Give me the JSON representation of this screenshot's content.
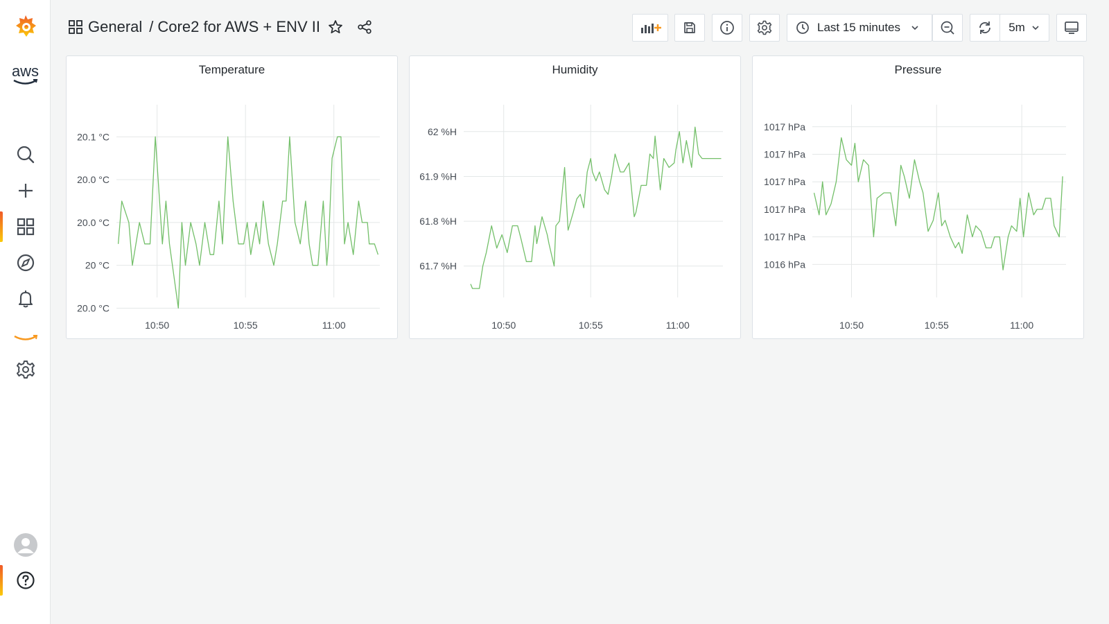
{
  "breadcrumb": {
    "folder": "General",
    "separator": "/",
    "dashboard": "Core2 for AWS + ENV II"
  },
  "icons": {
    "grafana_logo": "grafana-logo",
    "aws": "aws-logo",
    "search": "search-icon",
    "create": "plus-icon",
    "dashboards": "dashboards-icon",
    "explore": "compass-icon",
    "alerting": "bell-icon",
    "amazon": "amazon-smile-icon",
    "configuration": "gear-icon",
    "user": "avatar",
    "help": "help-icon"
  },
  "aws_label": "aws",
  "toolbar": {
    "time_range": "Last 15 minutes",
    "refresh_interval": "5m"
  },
  "colors": {
    "series": "#73bf69",
    "accent_start": "#f05a28",
    "accent_end": "#fbca0a",
    "grid": "#e4e7e7"
  },
  "panels": [
    {
      "title": "Temperature",
      "chart_data": {
        "type": "line",
        "title": "Temperature",
        "y_ticks": [
          "20.1 °C",
          "20.0 °C",
          "20.0 °C",
          "20 °C",
          "20.0 °C"
        ],
        "x_ticks": [
          "10:50",
          "10:55",
          "11:00"
        ],
        "ylim": [
          19.95,
          20.13
        ],
        "y_tick_values": [
          20.1,
          20.06,
          20.02,
          19.98,
          19.94
        ],
        "xlim_minutes": [
          47.7,
          62.6
        ],
        "x_tick_values": [
          50,
          55,
          60
        ],
        "series": [
          {
            "x": [
              47.8,
              48.0,
              48.4,
              48.6,
              49.0,
              49.3,
              49.6,
              49.9,
              50.3,
              50.5,
              50.7,
              51.2,
              51.4,
              51.6,
              51.9,
              52.2,
              52.4,
              52.7,
              53.0,
              53.2,
              53.5,
              53.7,
              54.0,
              54.3,
              54.6,
              54.9,
              55.1,
              55.3,
              55.6,
              55.8,
              56.0,
              56.3,
              56.6,
              56.8,
              57.1,
              57.3,
              57.5,
              57.8,
              58.1,
              58.4,
              58.6,
              58.8,
              59.1,
              59.4,
              59.6,
              59.7,
              59.9,
              60.2,
              60.4,
              60.6,
              60.8,
              61.1,
              61.4,
              61.6,
              61.9,
              62.0,
              62.3,
              62.5
            ],
            "y": [
              20.0,
              20.04,
              20.02,
              19.98,
              20.02,
              20.0,
              20.0,
              20.1,
              20.0,
              20.04,
              20.0,
              19.94,
              20.02,
              19.98,
              20.02,
              20.0,
              19.98,
              20.02,
              19.99,
              19.99,
              20.04,
              20.0,
              20.1,
              20.04,
              20.0,
              20.0,
              20.02,
              19.99,
              20.02,
              20.0,
              20.04,
              20.0,
              19.98,
              20.0,
              20.04,
              20.04,
              20.1,
              20.02,
              20.0,
              20.04,
              20.0,
              19.98,
              19.98,
              20.04,
              19.98,
              20.0,
              20.08,
              20.1,
              20.1,
              20.0,
              20.02,
              19.99,
              20.04,
              20.02,
              20.02,
              20.0,
              20.0,
              19.99
            ]
          }
        ]
      }
    },
    {
      "title": "Humidity",
      "chart_data": {
        "type": "line",
        "title": "Humidity",
        "y_ticks": [
          "62 %H",
          "61.9 %H",
          "61.8 %H",
          "61.7 %H"
        ],
        "x_ticks": [
          "10:50",
          "10:55",
          "11:00"
        ],
        "ylim": [
          61.63,
          62.06
        ],
        "y_tick_values": [
          62.0,
          61.9,
          61.8,
          61.7
        ],
        "xlim_minutes": [
          47.7,
          62.6
        ],
        "x_tick_values": [
          50,
          55,
          60
        ],
        "series": [
          {
            "x": [
              48.1,
              48.2,
              48.6,
              48.8,
              49.0,
              49.3,
              49.6,
              49.9,
              50.2,
              50.5,
              50.8,
              51.0,
              51.3,
              51.6,
              51.8,
              51.9,
              52.2,
              52.5,
              52.6,
              52.9,
              53.0,
              53.2,
              53.5,
              53.7,
              54.0,
              54.2,
              54.4,
              54.6,
              54.8,
              55.0,
              55.1,
              55.3,
              55.5,
              55.8,
              56.0,
              56.2,
              56.4,
              56.7,
              56.9,
              57.2,
              57.5,
              57.6,
              57.9,
              58.2,
              58.4,
              58.6,
              58.7,
              59.0,
              59.2,
              59.5,
              59.8,
              59.9,
              60.1,
              60.3,
              60.5,
              60.8,
              61.0,
              61.2,
              61.4,
              61.6,
              61.9,
              62.0,
              62.3,
              62.5
            ],
            "y": [
              61.66,
              61.65,
              61.65,
              61.7,
              61.73,
              61.79,
              61.74,
              61.77,
              61.73,
              61.79,
              61.79,
              61.76,
              61.71,
              61.71,
              61.79,
              61.75,
              61.81,
              61.77,
              61.75,
              61.7,
              61.79,
              61.8,
              61.92,
              61.78,
              61.82,
              61.85,
              61.86,
              61.83,
              61.91,
              61.94,
              61.91,
              61.89,
              61.91,
              61.87,
              61.86,
              61.9,
              61.95,
              61.91,
              61.91,
              61.93,
              61.81,
              61.82,
              61.88,
              61.88,
              61.95,
              61.94,
              61.99,
              61.87,
              61.94,
              61.92,
              61.93,
              61.96,
              62.0,
              61.93,
              61.98,
              61.92,
              62.01,
              61.95,
              61.94,
              61.94,
              61.94,
              61.94,
              61.94,
              61.94
            ]
          }
        ]
      }
    },
    {
      "title": "Pressure",
      "chart_data": {
        "type": "line",
        "title": "Pressure",
        "y_ticks": [
          "1017 hPa",
          "1017 hPa",
          "1017 hPa",
          "1017 hPa",
          "1017 hPa",
          "1016 hPa"
        ],
        "x_ticks": [
          "10:50",
          "10:55",
          "11:00"
        ],
        "ylim": [
          1016.88,
          1017.58
        ],
        "y_tick_values": [
          1017.5,
          1017.4,
          1017.3,
          1017.2,
          1017.1,
          1017.0
        ],
        "xlim_minutes": [
          47.7,
          62.6
        ],
        "x_tick_values": [
          50,
          55,
          60
        ],
        "series": [
          {
            "x": [
              47.8,
              48.1,
              48.3,
              48.5,
              48.8,
              49.1,
              49.4,
              49.7,
              50.0,
              50.2,
              50.4,
              50.7,
              51.0,
              51.3,
              51.5,
              51.9,
              52.1,
              52.3,
              52.6,
              52.9,
              53.1,
              53.4,
              53.7,
              54.0,
              54.2,
              54.5,
              54.8,
              55.1,
              55.3,
              55.5,
              55.8,
              56.1,
              56.3,
              56.5,
              56.8,
              57.1,
              57.3,
              57.6,
              57.9,
              58.2,
              58.4,
              58.7,
              58.9,
              59.2,
              59.4,
              59.7,
              59.9,
              60.1,
              60.4,
              60.7,
              60.9,
              61.2,
              61.4,
              61.7,
              61.9,
              62.2,
              62.4
            ],
            "y": [
              1017.26,
              1017.18,
              1017.3,
              1017.18,
              1017.22,
              1017.3,
              1017.46,
              1017.38,
              1017.36,
              1017.44,
              1017.3,
              1017.38,
              1017.36,
              1017.1,
              1017.24,
              1017.26,
              1017.26,
              1017.26,
              1017.14,
              1017.36,
              1017.32,
              1017.24,
              1017.38,
              1017.3,
              1017.26,
              1017.12,
              1017.16,
              1017.26,
              1017.14,
              1017.16,
              1017.1,
              1017.06,
              1017.08,
              1017.04,
              1017.18,
              1017.1,
              1017.14,
              1017.12,
              1017.06,
              1017.06,
              1017.1,
              1017.1,
              1016.98,
              1017.1,
              1017.14,
              1017.12,
              1017.24,
              1017.1,
              1017.26,
              1017.18,
              1017.2,
              1017.2,
              1017.24,
              1017.24,
              1017.14,
              1017.1,
              1017.32
            ]
          }
        ]
      }
    }
  ]
}
